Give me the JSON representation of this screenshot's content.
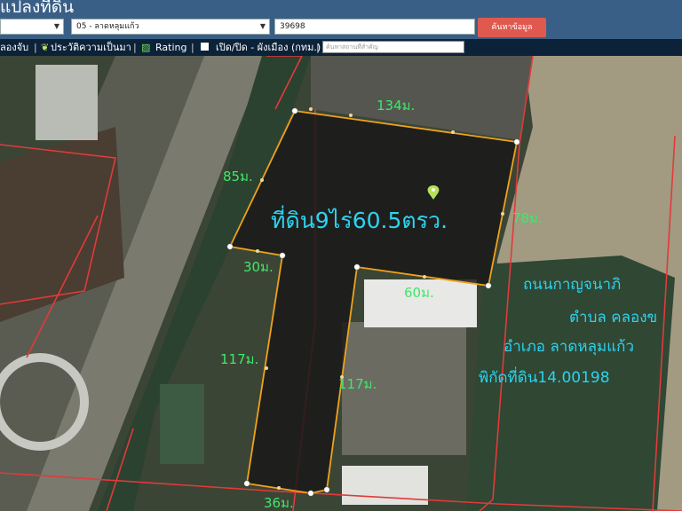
{
  "header": {
    "title": "แปลงที่ดิน",
    "province_select": "",
    "district_select": "05 - ลาดหลุมแก้ว",
    "parcel_number": "39698",
    "search_button": "ค้นหาข้อมูล"
  },
  "toolbar": {
    "item_parcel": "ลองจับ",
    "item_history": "ประวัติความเป็นมา",
    "item_rating": "Rating",
    "item_toggle": "เปิด/ปิด - ผังเมือง (กทม.)",
    "search_placeholder": "ค้นหาสถานที่สำคัญ"
  },
  "map": {
    "area_label": "ที่ดิน9ไร่60.5ตรว.",
    "dimensions": {
      "top": "134ม.",
      "left_upper": "85ม.",
      "right": "78ม.",
      "notch": "30ม.",
      "inner": "60ม.",
      "left_lower": "117ม.",
      "inner_lower": "117ม.",
      "bottom": "36ม."
    },
    "info": {
      "road": "ถนนกาญจนาภิ",
      "subdistrict": "ตำบล คลองข",
      "district": "อำเภอ ลาดหลุมแก้ว",
      "coords": "พิกัดที่ดิน14.00198"
    },
    "colors": {
      "parcel_outline": "#f0a21a",
      "label_green": "#3ee86b",
      "label_cyan": "#2cd3f0",
      "boundary_red": "#e23a3a"
    }
  }
}
